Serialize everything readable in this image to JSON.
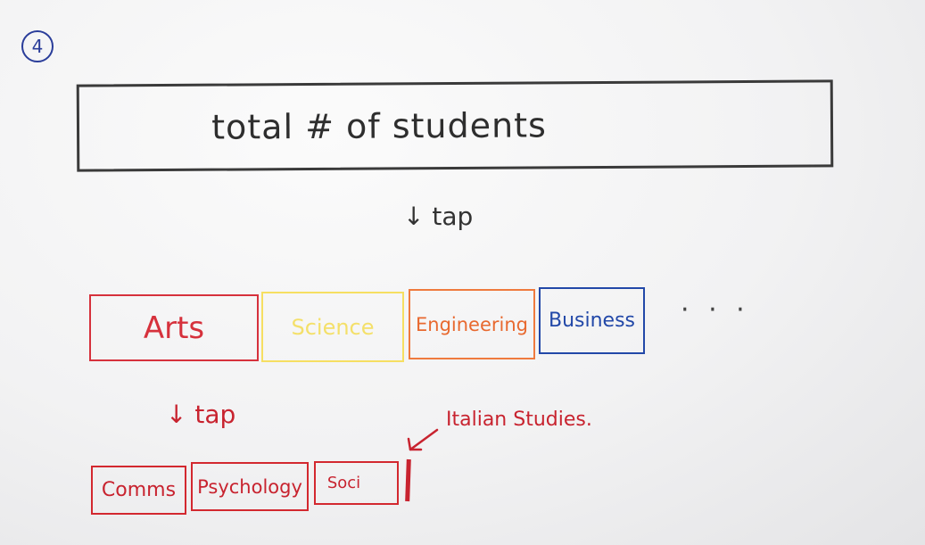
{
  "step_number": "4",
  "top_box": {
    "label": "total # of students"
  },
  "tap_arrow_1": {
    "arrow": "↓",
    "label": "tap"
  },
  "faculties": [
    {
      "label": "Arts",
      "color": "#d6313c"
    },
    {
      "label": "Science",
      "color": "#f4e06a"
    },
    {
      "label": "Engineering",
      "color": "#e8692f"
    },
    {
      "label": "Business",
      "color": "#2248a8"
    }
  ],
  "more_indicator": "· · ·",
  "tap_arrow_2": {
    "arrow": "↓",
    "label": "tap"
  },
  "subjects": [
    {
      "label": "Comms"
    },
    {
      "label": "Psychology"
    },
    {
      "label": "Soci"
    }
  ],
  "annotation": {
    "label": "Italian Studies."
  },
  "colors": {
    "ink": "#3a3a3a",
    "red": "#c8232f",
    "badge": "#2a3d9a"
  }
}
